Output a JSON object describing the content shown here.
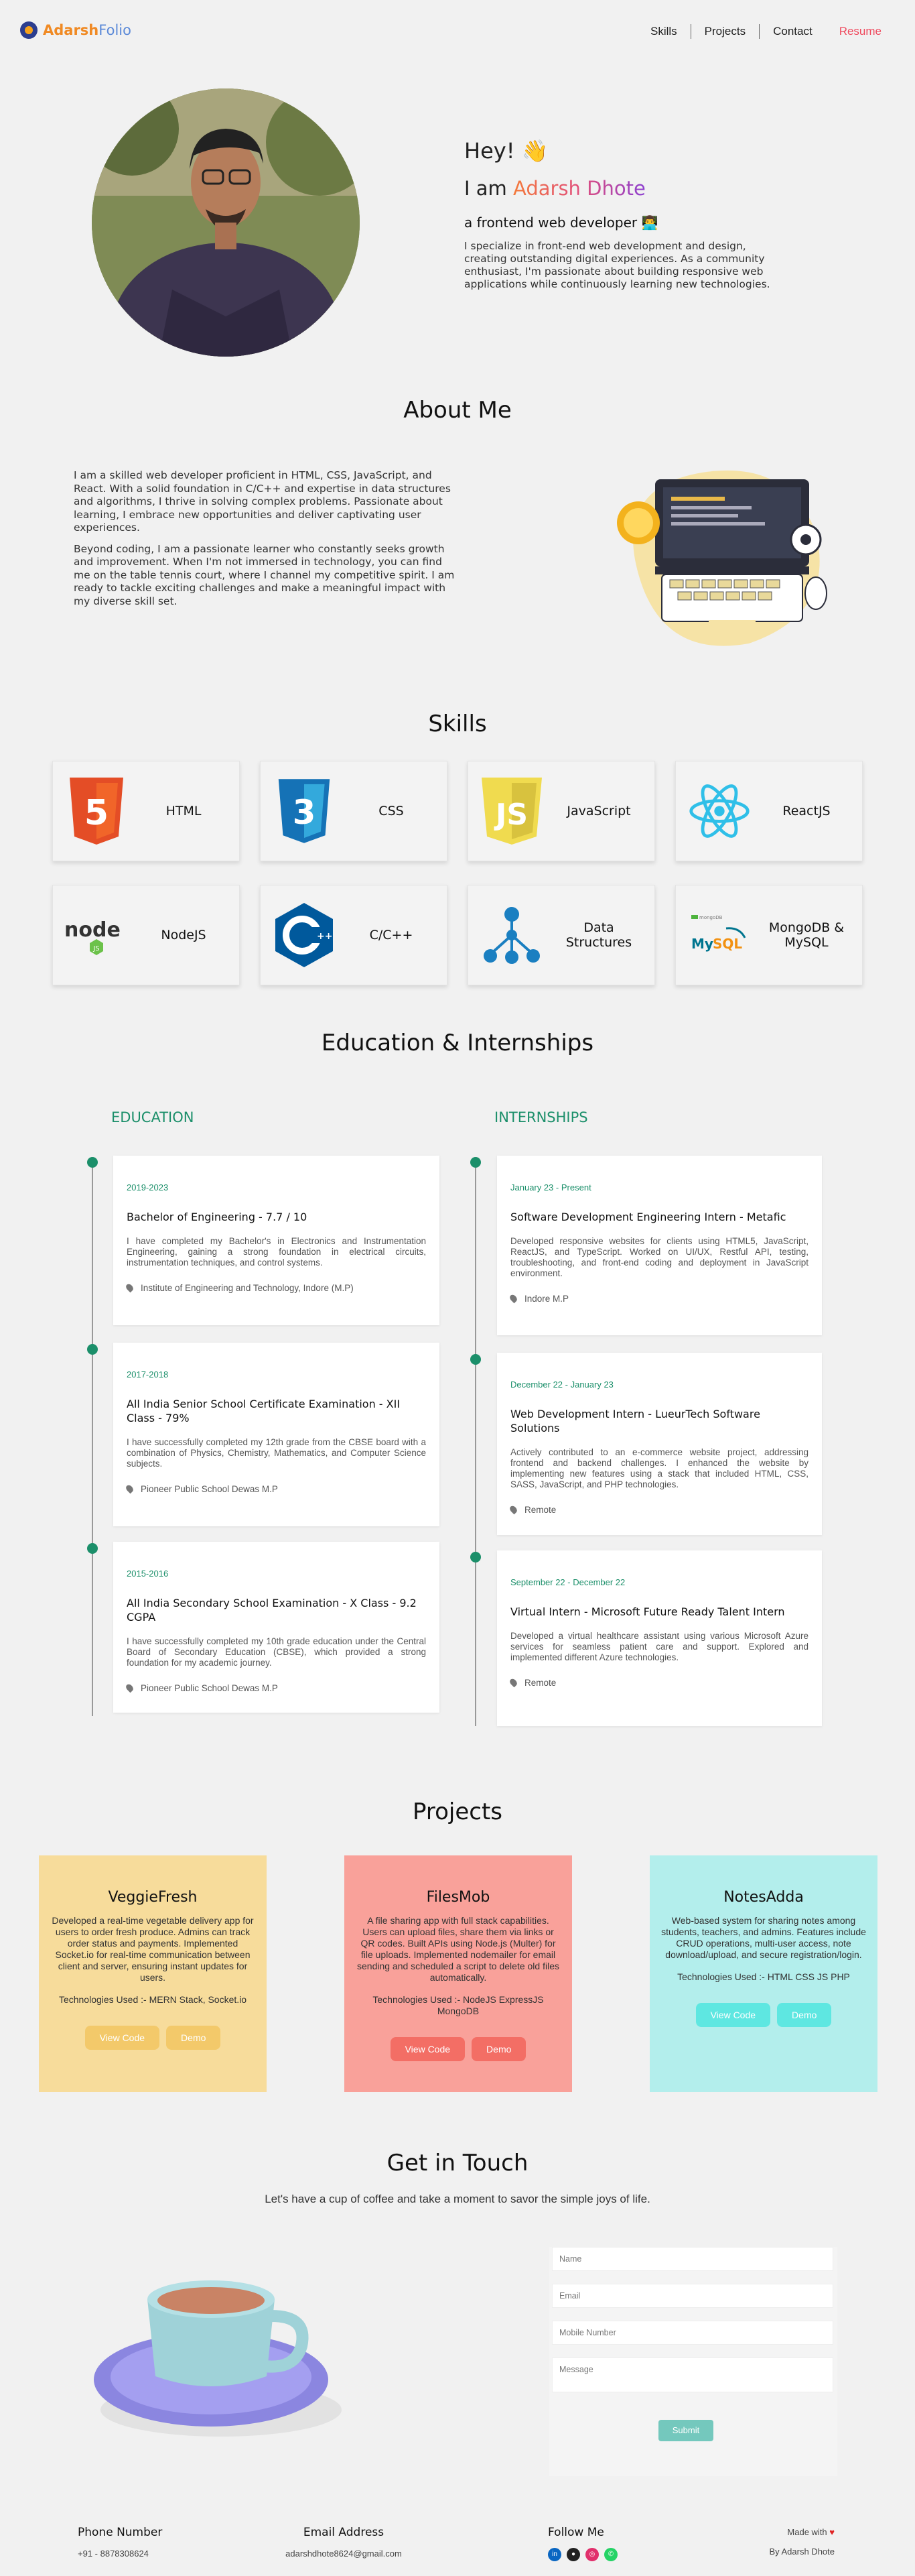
{
  "nav": {
    "logo_part1": "Adarsh",
    "logo_part2": "Folio",
    "links": [
      "Skills",
      "Projects",
      "Contact"
    ],
    "resume": "Resume"
  },
  "hero": {
    "greeting": "Hey! 👋",
    "iam_prefix": "I am ",
    "name": "Adarsh Dhote",
    "role": "a frontend web developer 👨‍💻",
    "description": "I specialize in front-end web development and design, creating outstanding digital experiences. As a community enthusiast, I'm passionate about building responsive web applications while continuously learning new technologies."
  },
  "about": {
    "title": "About Me",
    "p1": "I am a skilled web developer proficient in HTML, CSS, JavaScript, and React. With a solid foundation in C/C++ and expertise in data structures and algorithms, I thrive in solving complex problems. Passionate about learning, I embrace new opportunities and deliver captivating user experiences.",
    "p2": "Beyond coding, I am a passionate learner who constantly seeks growth and improvement. When I'm not immersed in technology, you can find me on the table tennis court, where I channel my competitive spirit. I am ready to tackle exciting challenges and make a meaningful impact with my diverse skill set."
  },
  "skills": {
    "title": "Skills",
    "items": [
      {
        "name": "HTML",
        "icon": "html5-icon"
      },
      {
        "name": "CSS",
        "icon": "css3-icon"
      },
      {
        "name": "JavaScript",
        "icon": "javascript-icon"
      },
      {
        "name": "ReactJS",
        "icon": "react-icon"
      },
      {
        "name": "NodeJS",
        "icon": "nodejs-icon"
      },
      {
        "name": "C/C++",
        "icon": "cpp-icon"
      },
      {
        "name": "Data Structures",
        "icon": "data-structures-icon"
      },
      {
        "name": "MongoDB & MySQL",
        "icon": "mongodb-mysql-icon"
      }
    ]
  },
  "edu_title": "Education & Internships",
  "education": {
    "heading": "EDUCATION",
    "items": [
      {
        "date": "2019-2023",
        "title": "Bachelor of Engineering - 7.7 / 10",
        "text": "I have completed my Bachelor's in Electronics and Instrumentation Engineering, gaining a strong foundation in electrical circuits, instrumentation techniques, and control systems.",
        "location": "Institute of Engineering and Technology, Indore (M.P)"
      },
      {
        "date": "2017-2018",
        "title": "All India Senior School Certificate Examination - XII Class - 79%",
        "text": "I have successfully completed my 12th grade from the CBSE board with a combination of Physics, Chemistry, Mathematics, and Computer Science subjects.",
        "location": "Pioneer Public School Dewas M.P"
      },
      {
        "date": "2015-2016",
        "title": "All India Secondary School Examination - X Class - 9.2 CGPA",
        "text": "I have successfully completed my 10th grade education under the Central Board of Secondary Education (CBSE), which provided a strong foundation for my academic journey.",
        "location": "Pioneer Public School Dewas M.P"
      }
    ]
  },
  "internships": {
    "heading": "INTERNSHIPS",
    "items": [
      {
        "date": "January 23 - Present",
        "title": "Software Development Engineering Intern - Metafic",
        "text": "Developed responsive websites for clients using HTML5, JavaScript, ReactJS, and TypeScript. Worked on UI/UX, Restful API, testing, troubleshooting, and front-end coding and deployment in JavaScript environment.",
        "location": "Indore M.P"
      },
      {
        "date": "December 22 - January 23",
        "title": "Web Development Intern - LueurTech Software Solutions",
        "text": "Actively contributed to an e-commerce website project, addressing frontend and backend challenges. I enhanced the website by implementing new features using a stack that included HTML, CSS, SASS, JavaScript, and PHP technologies.",
        "location": "Remote"
      },
      {
        "date": "September 22 - December 22",
        "title": "Virtual Intern - Microsoft Future Ready Talent Intern",
        "text": "Developed a virtual healthcare assistant using various Microsoft Azure services for seamless patient care and support. Explored and implemented different Azure technologies.",
        "location": "Remote"
      }
    ]
  },
  "projects": {
    "title": "Projects",
    "items": [
      {
        "name": "VeggieFresh",
        "description": "Developed a real-time vegetable delivery app for users to order fresh produce. Admins can track order status and payments. Implemented Socket.io for real-time communication between client and server, ensuring instant updates for users.",
        "tech": "Technologies Used :- MERN Stack, Socket.io",
        "code_label": "View Code",
        "demo_label": "Demo",
        "bg": "#f7dc9b",
        "btn": "#f3c96a"
      },
      {
        "name": "FilesMob",
        "description": "A file sharing app with full stack capabilities. Users can upload files, share them via links or QR codes. Built APIs using Node.js (Multer) for file uploads. Implemented nodemailer for email sending and scheduled a script to delete old files automatically.",
        "tech": "Technologies Used :- NodeJS ExpressJS MongoDB",
        "code_label": "View Code",
        "demo_label": "Demo",
        "bg": "#f9a19a",
        "btn": "#f36e65"
      },
      {
        "name": "NotesAdda",
        "description": "Web-based system for sharing notes among students, teachers, and admins. Features include CRUD operations, multi-user access, note download/upload, and secure registration/login.",
        "tech": "Technologies Used :- HTML CSS JS PHP",
        "code_label": "View Code",
        "demo_label": "Demo",
        "bg": "#b3eeec",
        "btn": "#5ee7e1"
      }
    ]
  },
  "contact": {
    "title": "Get in Touch",
    "subtitle": "Let's have a cup of coffee and take a moment to savor the simple joys of life.",
    "name_ph": "Name",
    "email_ph": "Email",
    "mobile_ph": "Mobile Number",
    "message_ph": "Message",
    "submit": "Submit"
  },
  "footer": {
    "phone_label": "Phone Number",
    "phone": "+91 - 8878308624",
    "email_label": "Email Address",
    "email": "adarshdhote8624@gmail.com",
    "follow_label": "Follow Me",
    "made_with": "Made with",
    "by": "By Adarsh Dhote",
    "socials": [
      "linkedin-icon",
      "github-icon",
      "instagram-icon",
      "whatsapp-icon"
    ]
  }
}
